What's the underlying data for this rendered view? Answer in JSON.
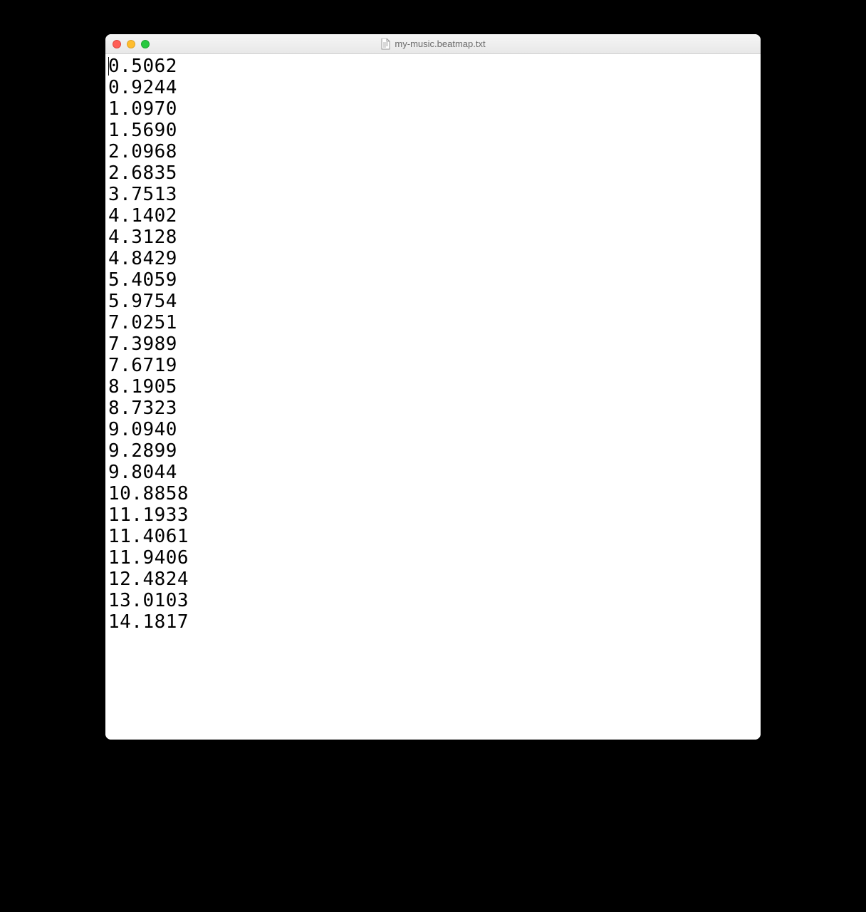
{
  "window": {
    "title": "my-music.beatmap.txt",
    "traffic_light_red": "#ff5f57",
    "traffic_light_yellow": "#ffbd2e",
    "traffic_light_green": "#28c940"
  },
  "document": {
    "lines": [
      "0.5062",
      "0.9244",
      "1.0970",
      "1.5690",
      "2.0968",
      "2.6835",
      "3.7513",
      "4.1402",
      "4.3128",
      "4.8429",
      "5.4059",
      "5.9754",
      "7.0251",
      "7.3989",
      "7.6719",
      "8.1905",
      "8.7323",
      "9.0940",
      "9.2899",
      "9.8044",
      "10.8858",
      "11.1933",
      "11.4061",
      "11.9406",
      "12.4824",
      "13.0103",
      "14.1817"
    ]
  }
}
